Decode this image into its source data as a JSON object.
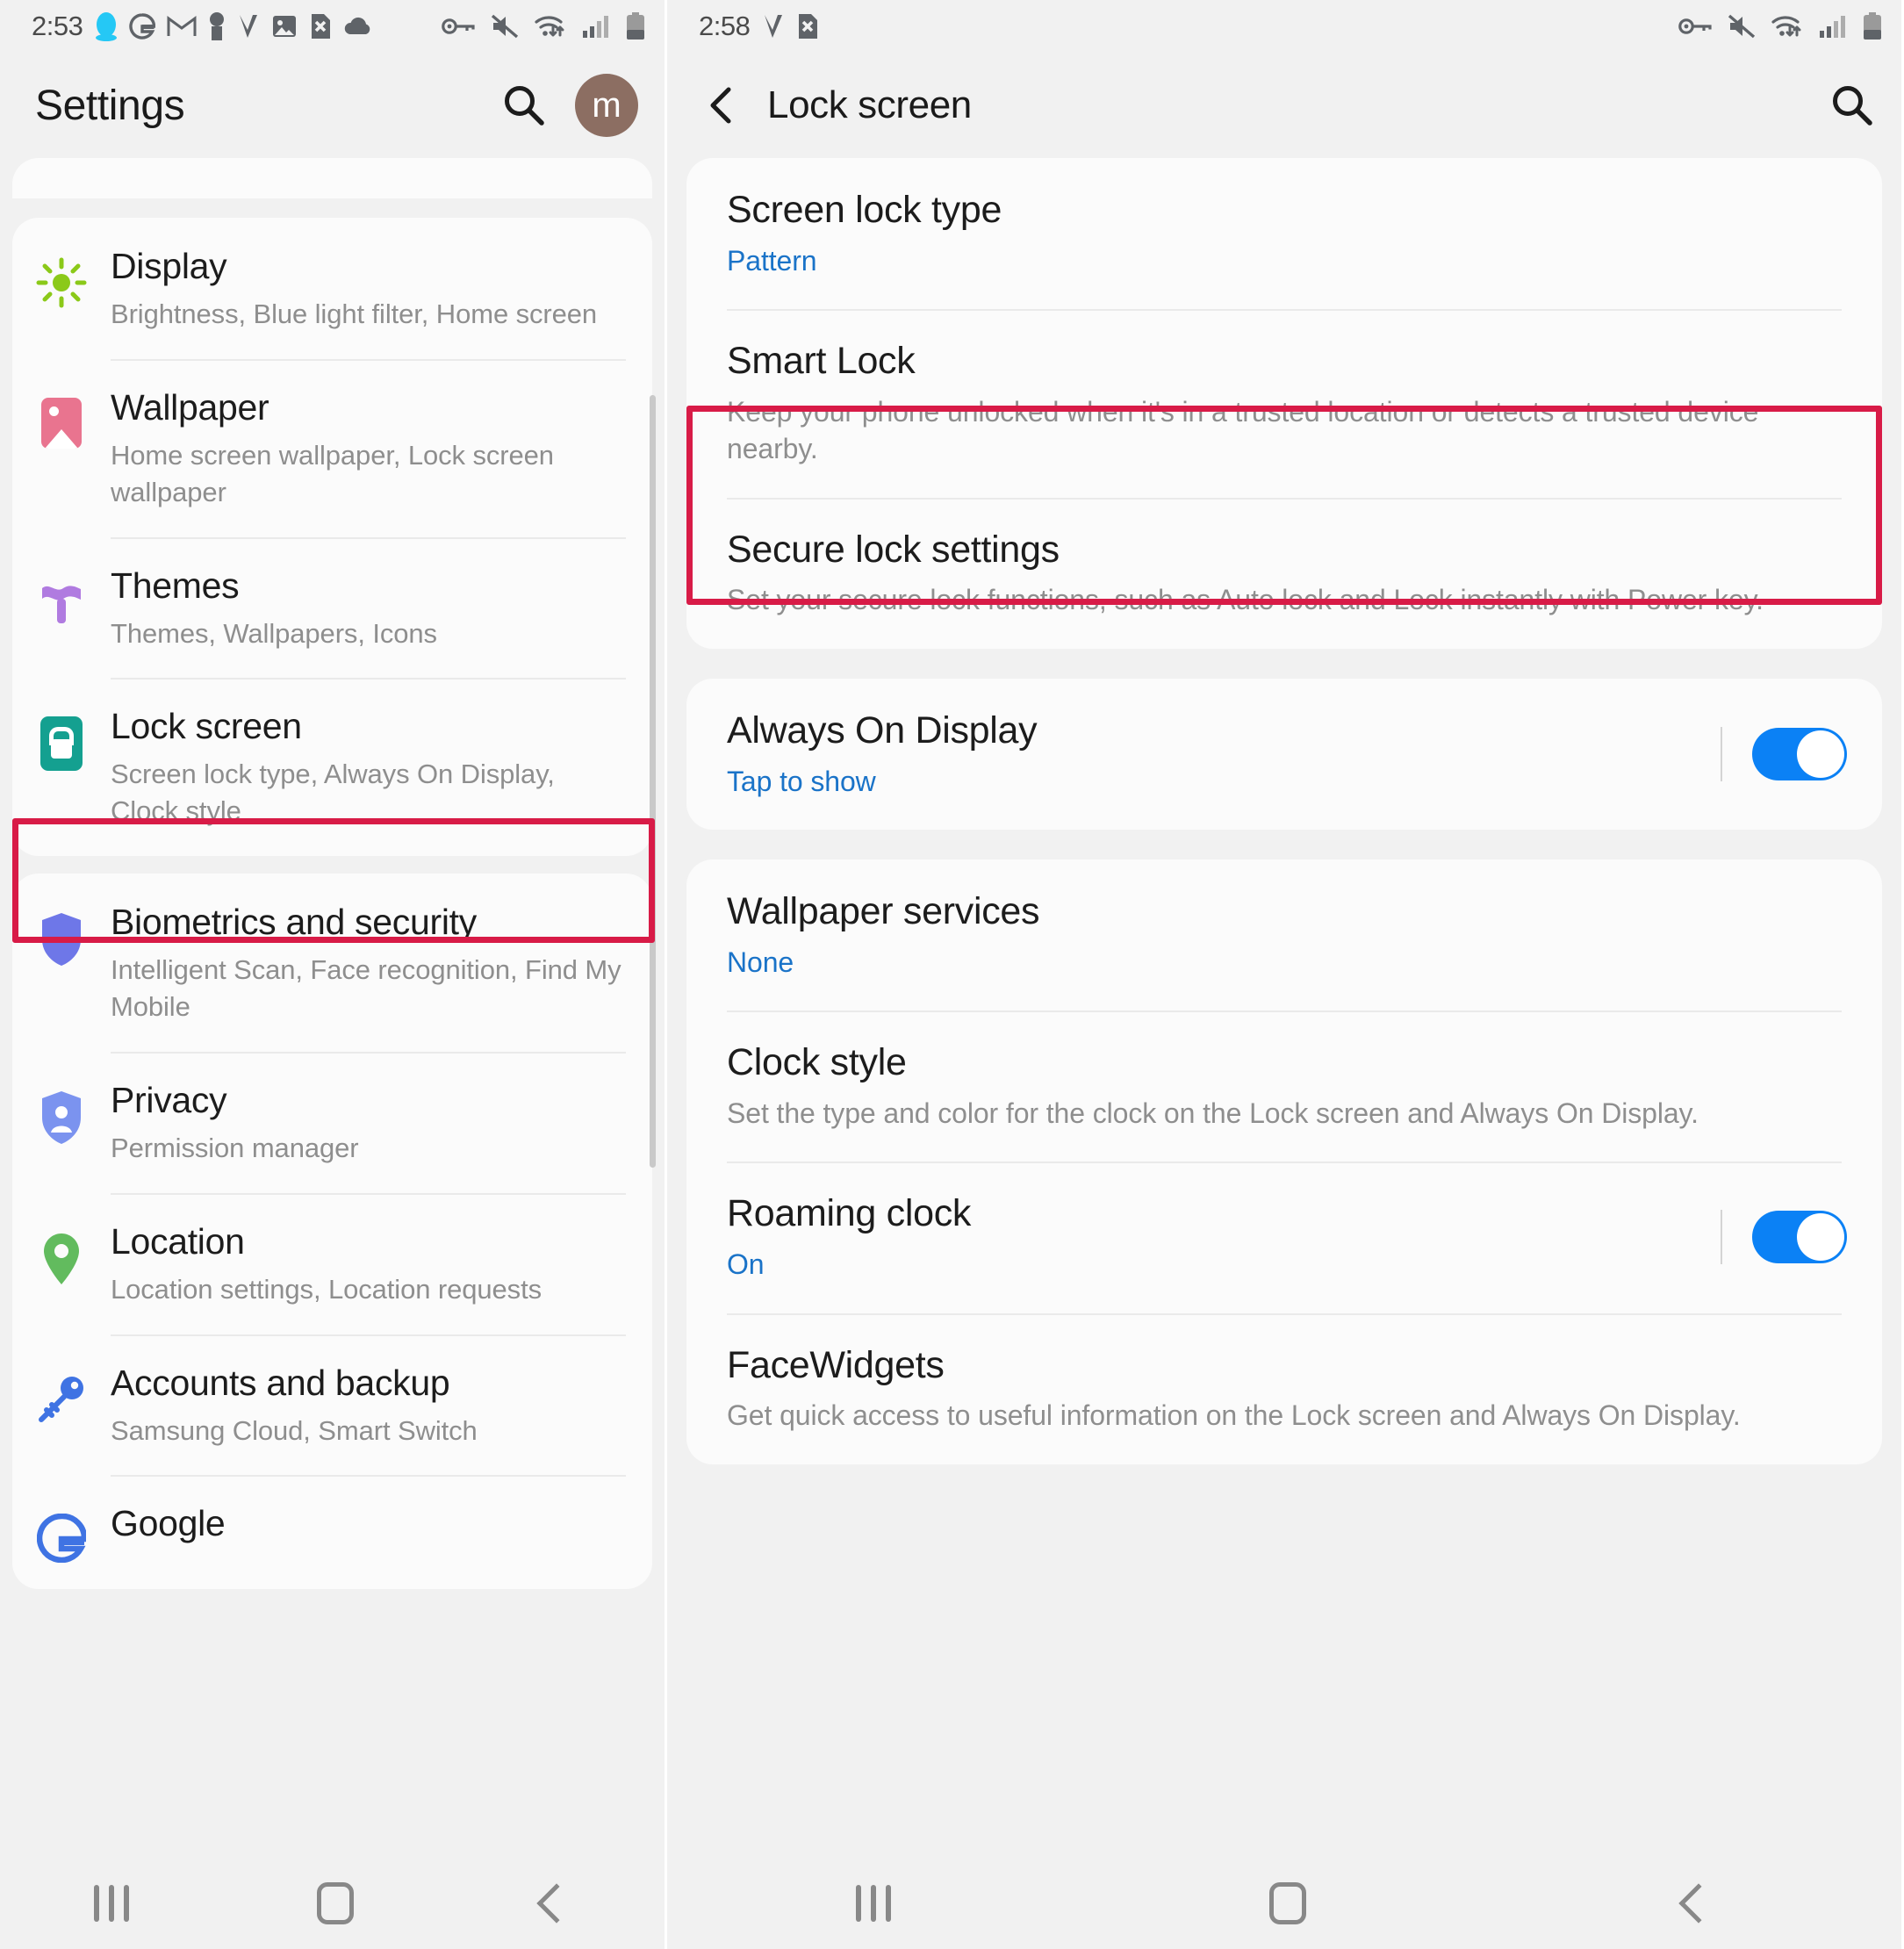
{
  "left": {
    "statusbar": {
      "time": "2:53",
      "left_icons": [
        "qq-penguin-icon",
        "google-g-icon",
        "gmail-icon",
        "keyhole-icon",
        "v-app-icon",
        "broken-image-icon",
        "file-x-icon",
        "cloud-icon"
      ],
      "right_icons": [
        "vpn-key-icon",
        "mute-icon",
        "wifi-transfer-icon",
        "signal-bars-icon",
        "battery-icon"
      ]
    },
    "appbar": {
      "title": "Settings",
      "search_icon": "search-icon",
      "avatar_letter": "m"
    },
    "groups": [
      {
        "items": [
          {
            "icon": "brightness-icon",
            "title": "Display",
            "subtitle": "Brightness, Blue light filter, Home screen"
          },
          {
            "icon": "wallpaper-icon",
            "title": "Wallpaper",
            "subtitle": "Home screen wallpaper, Lock screen wallpaper"
          },
          {
            "icon": "themes-icon",
            "title": "Themes",
            "subtitle": "Themes, Wallpapers, Icons"
          },
          {
            "icon": "lock-icon",
            "title": "Lock screen",
            "subtitle": "Screen lock type, Always On Display, Clock style",
            "highlighted": true
          }
        ]
      },
      {
        "items": [
          {
            "icon": "shield-icon",
            "title": "Biometrics and security",
            "subtitle": "Intelligent Scan, Face recognition, Find My Mobile"
          },
          {
            "icon": "privacy-shield-icon",
            "title": "Privacy",
            "subtitle": "Permission manager"
          },
          {
            "icon": "location-pin-icon",
            "title": "Location",
            "subtitle": "Location settings, Location requests"
          },
          {
            "icon": "key-icon",
            "title": "Accounts and backup",
            "subtitle": "Samsung Cloud, Smart Switch"
          },
          {
            "icon": "google-icon",
            "title": "Google",
            "subtitle": ""
          }
        ]
      }
    ],
    "navbar": {
      "recents": "recents-icon",
      "home": "home-icon",
      "back": "back-icon"
    }
  },
  "right": {
    "statusbar": {
      "time": "2:58",
      "left_icons": [
        "v-app-icon",
        "file-x-icon"
      ],
      "right_icons": [
        "vpn-key-icon",
        "mute-icon",
        "wifi-transfer-icon",
        "signal-bars-icon",
        "battery-icon"
      ]
    },
    "appbar": {
      "back_icon": "back-chevron-icon",
      "title": "Lock screen",
      "search_icon": "search-icon"
    },
    "groups": [
      {
        "items": [
          {
            "title": "Screen lock type",
            "subtitle": "Pattern",
            "subtitle_link": true
          },
          {
            "title": "Smart Lock",
            "subtitle": "Keep your phone unlocked when it's in a trusted location or detects a trusted device nearby.",
            "highlighted": true
          },
          {
            "title": "Secure lock settings",
            "subtitle": "Set your secure lock functions, such as Auto lock and Lock instantly with Power key."
          }
        ]
      },
      {
        "items": [
          {
            "title": "Always On Display",
            "subtitle": "Tap to show",
            "subtitle_link": true,
            "toggle": "on"
          }
        ]
      },
      {
        "items": [
          {
            "title": "Wallpaper services",
            "subtitle": "None",
            "subtitle_link": true
          },
          {
            "title": "Clock style",
            "subtitle": "Set the type and color for the clock on the Lock screen and Always On Display."
          },
          {
            "title": "Roaming clock",
            "subtitle": "On",
            "subtitle_link": true,
            "toggle": "on"
          },
          {
            "title": "FaceWidgets",
            "subtitle": "Get quick access to useful information on the Lock screen and Always On Display."
          }
        ]
      }
    ],
    "navbar": {
      "recents": "recents-icon",
      "home": "home-icon",
      "back": "back-icon"
    }
  },
  "colors": {
    "highlight": "#d81b47",
    "link": "#1a73c8",
    "toggle_on": "#0b81f5",
    "background": "#f1f1f1",
    "card": "#fbfbfb"
  }
}
